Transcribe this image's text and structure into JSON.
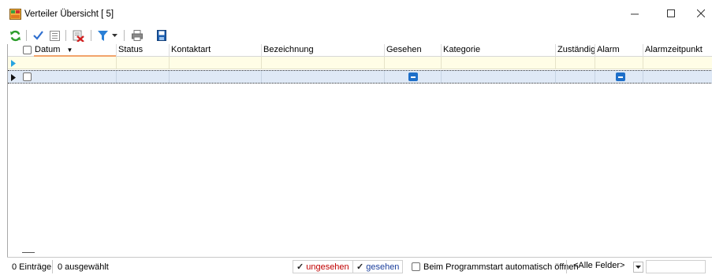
{
  "window": {
    "title": "Verteiler Übersicht [ 5]",
    "min_icon": "minimize-icon",
    "max_icon": "maximize-icon",
    "close_icon": "close-icon"
  },
  "toolbar": {
    "icons": [
      "refresh-icon",
      "checkmark-icon",
      "list-view-icon",
      "delete-icon",
      "filter-icon",
      "filter-dropdown-icon",
      "print-icon",
      "save-icon"
    ]
  },
  "grid": {
    "columns": [
      {
        "label": "Datum",
        "sorted": "desc"
      },
      {
        "label": "Status"
      },
      {
        "label": "Kontaktart"
      },
      {
        "label": "Bezeichnung"
      },
      {
        "label": "Gesehen"
      },
      {
        "label": "Kategorie"
      },
      {
        "label": "Zuständig"
      },
      {
        "label": "Alarm"
      },
      {
        "label": "Alarmzeitpunkt"
      }
    ],
    "colors": {
      "filter_row": "#fffde6",
      "selected_row": "#dfe9f6",
      "checkbox_blue": "#1e6fc9",
      "sort_underline": "#f2a36b"
    }
  },
  "status": {
    "entries": "0 Einträge",
    "selected": "0 ausgewählt",
    "unseen_label": "ungesehen",
    "seen_label": "gesehen",
    "autostart_label": "Beim Programmstart automatisch öffnen",
    "field_select": "<Alle Felder>",
    "colors": {
      "unseen": "#c00000",
      "seen": "#1b3f9c"
    }
  }
}
